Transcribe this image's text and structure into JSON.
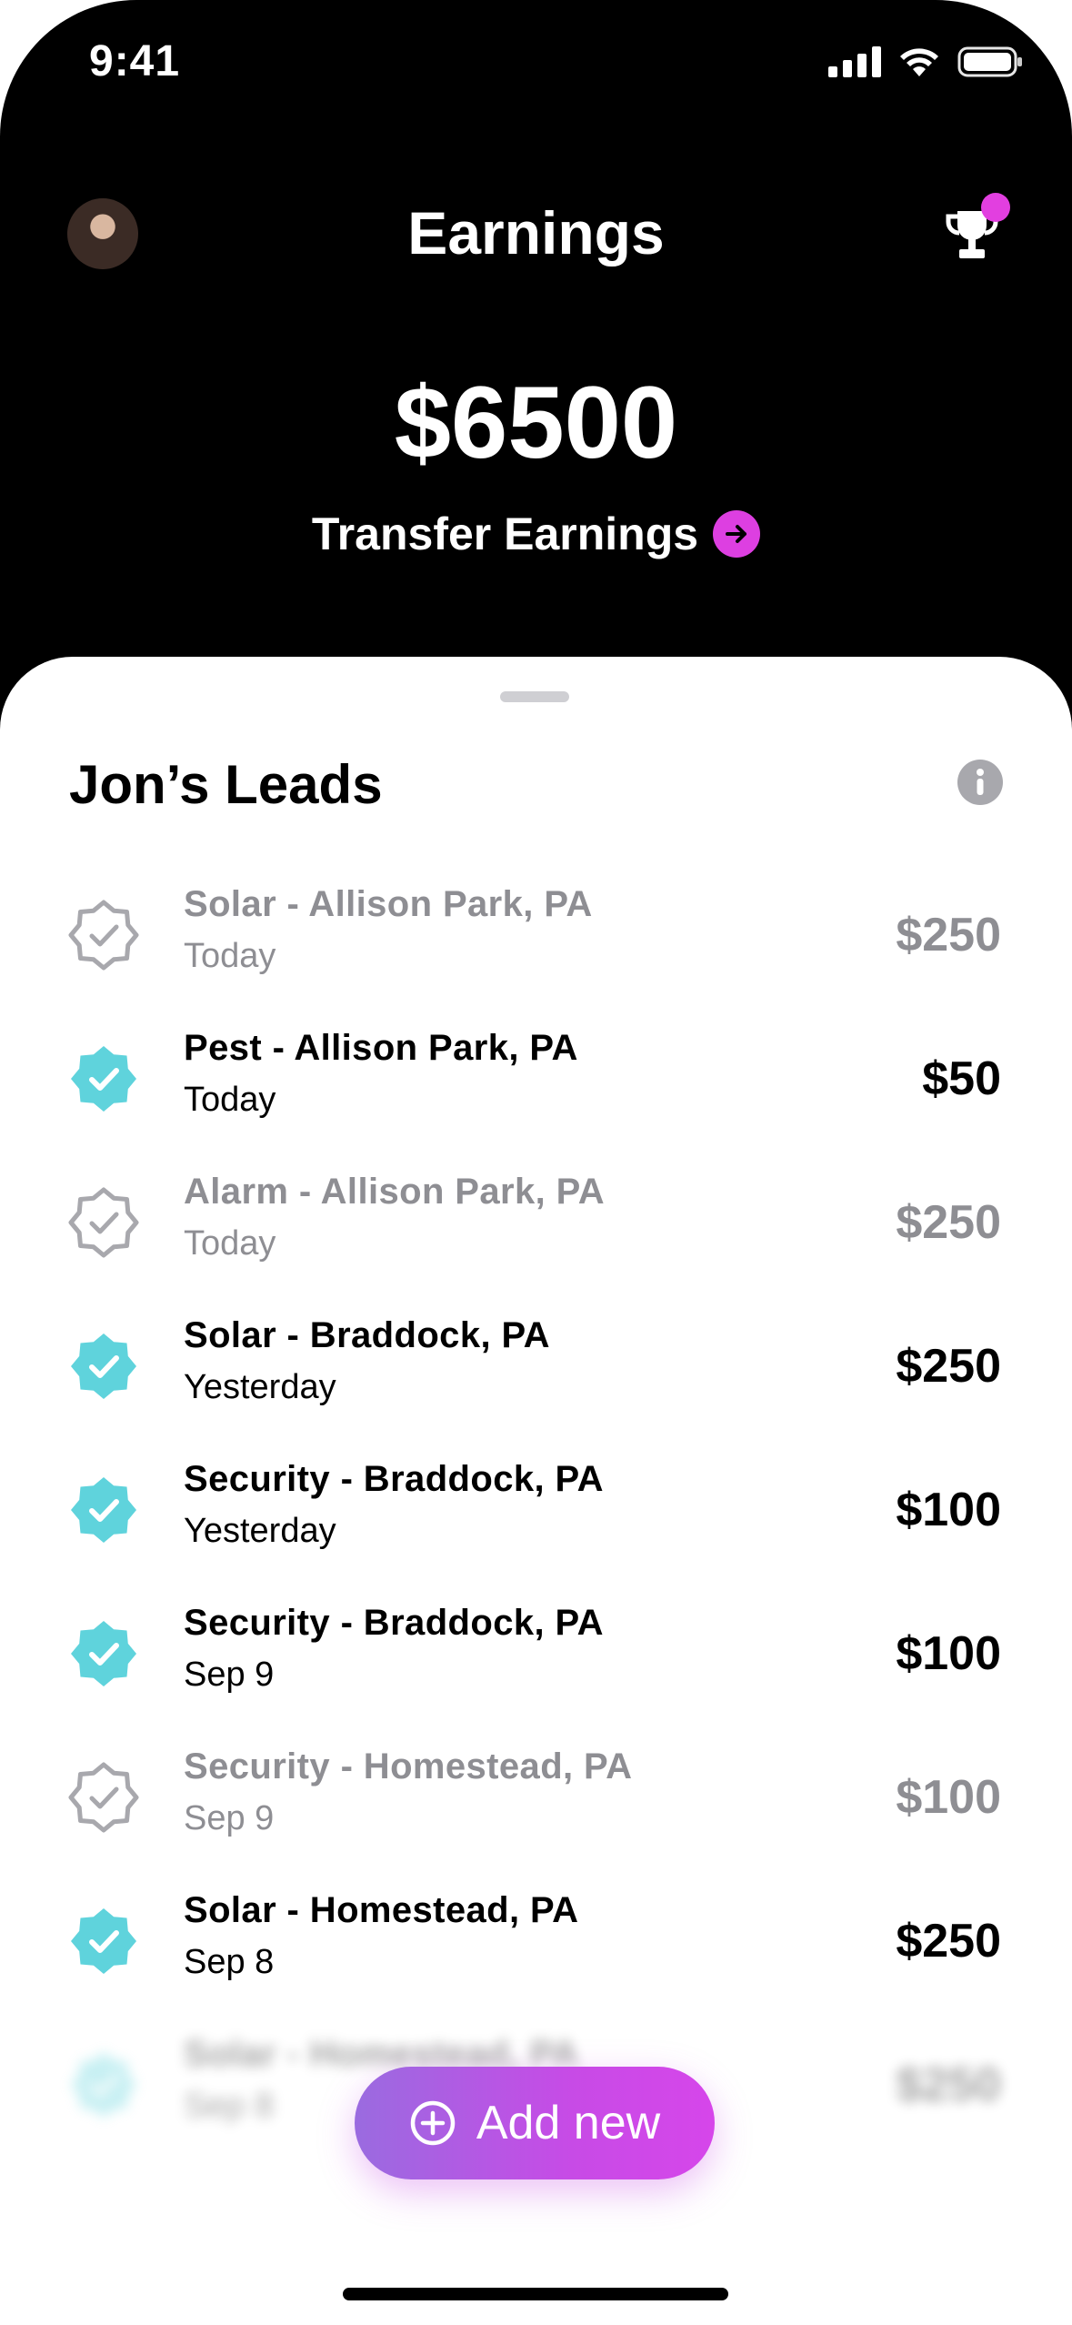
{
  "status": {
    "time": "9:41"
  },
  "header": {
    "title": "Earnings",
    "balance": "$6500",
    "transfer_label": "Transfer Earnings"
  },
  "sheet": {
    "title": "Jon’s Leads",
    "leads": [
      {
        "name": "Solar - Allison Park, PA",
        "date": "Today",
        "amount": "$250",
        "verified": false
      },
      {
        "name": "Pest - Allison Park, PA",
        "date": "Today",
        "amount": "$50",
        "verified": true
      },
      {
        "name": "Alarm - Allison Park, PA",
        "date": "Today",
        "amount": "$250",
        "verified": false
      },
      {
        "name": "Solar - Braddock, PA",
        "date": "Yesterday",
        "amount": "$250",
        "verified": true
      },
      {
        "name": "Security - Braddock, PA",
        "date": "Yesterday",
        "amount": "$100",
        "verified": true
      },
      {
        "name": "Security - Braddock, PA",
        "date": "Sep 9",
        "amount": "$100",
        "verified": true
      },
      {
        "name": "Security - Homestead, PA",
        "date": "Sep 9",
        "amount": "$100",
        "verified": false
      },
      {
        "name": "Solar - Homestead, PA",
        "date": "Sep 8",
        "amount": "$250",
        "verified": true
      },
      {
        "name": "Solar - Homestead, PA",
        "date": "Sep 8",
        "amount": "$250",
        "verified": true
      }
    ]
  },
  "actions": {
    "add_new_label": "Add new"
  },
  "colors": {
    "accent": "#dd3fe1",
    "verified": "#5fd3dc",
    "muted": "#8e8e93"
  },
  "icons": {
    "trophy": "trophy-icon",
    "info": "info-icon",
    "verified_badge": "verified-badge-icon",
    "unverified_badge": "unverified-badge-icon",
    "add": "plus-circle-icon",
    "arrow": "arrow-right-circle-icon"
  }
}
